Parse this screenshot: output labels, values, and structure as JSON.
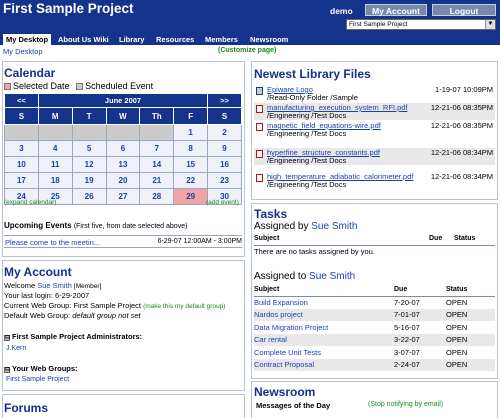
{
  "header": {
    "title": "First Sample Project",
    "user": "demo",
    "my_account_button": "My Account",
    "logout_button": "Logout",
    "project_select_value": "First Sample Project"
  },
  "nav": {
    "tabs": [
      "My Desktop",
      "About Us Wiki",
      "Library",
      "Resources",
      "Members",
      "Newsroom"
    ],
    "breadcrumb": "My Desktop",
    "customize": "(Customize page)"
  },
  "calendar": {
    "title": "Calendar",
    "legend_selected": "Selected Date",
    "legend_scheduled": "Scheduled Event",
    "prev": "<<",
    "month": "June 2007",
    "next": ">>",
    "days": [
      "S",
      "M",
      "T",
      "W",
      "Th",
      "F",
      "S"
    ],
    "weeks": [
      [
        "",
        "",
        "",
        "",
        "",
        "1",
        "2"
      ],
      [
        "3",
        "4",
        "5",
        "6",
        "7",
        "8",
        "9"
      ],
      [
        "10",
        "11",
        "12",
        "13",
        "14",
        "15",
        "16"
      ],
      [
        "17",
        "18",
        "19",
        "20",
        "21",
        "22",
        "23"
      ],
      [
        "24",
        "25",
        "26",
        "27",
        "28",
        "29",
        "30"
      ]
    ],
    "selected_day": "29",
    "expand_link": "(expand calendar)",
    "add_event_link": "(add event)",
    "upcoming_title": "Upcoming Events",
    "upcoming_note": "(First five, from date selected above)",
    "event_name": "Please come to the meetin...",
    "event_time": "6-29-07 12:00AM - 3:00PM",
    "colors": {
      "header": "#14338a",
      "selected": "#f2a3a6",
      "scheduled": "#c8d0e0",
      "empty": "#cbcbcb"
    }
  },
  "account": {
    "title": "My Account",
    "welcome_prefix": "Welcome",
    "user_name": "Sue Smith",
    "role": "[Member]",
    "last_login": "Your last login: 6-29-2007",
    "current_group": "Current Web Group: First Sample Project",
    "make_default": "(make this my default group)",
    "default_group_label": "Default Web Group:",
    "default_group_value": "default group not set",
    "admins_title": "First Sample Project Administrators:",
    "admin_name": "J.Kern",
    "groups_title": "Your Web Groups:",
    "group_name": "First Sample Project",
    "expand_glyph": "⊟"
  },
  "forums": {
    "title": "Forums"
  },
  "library": {
    "title": "Newest Library Files",
    "files": [
      {
        "name": "Epiware Logo",
        "date": "1-19-07 10:09PM",
        "path": "/Read-Only Folder /Sample",
        "icon": "folder-icon"
      },
      {
        "name": "manufacturing_execution_system_RFI.pdf",
        "date": "12-21-06 08:35PM",
        "path": "/Engineering /Test Docs",
        "icon": "pdf-icon"
      },
      {
        "name": "magnetic_field_equations-wire.pdf",
        "date": "12-21-06 08:35PM",
        "path": "/Engineering /Test Docs",
        "icon": "pdf-icon"
      },
      {
        "name": "hyperfine_structure_constants.pdf",
        "date": "12-21-06 08:34PM",
        "path": "/Engineering /Test Docs",
        "icon": "pdf-icon"
      },
      {
        "name": "high_temperature_adiabatic_calorimeter.pdf",
        "date": "12-21-06 08:34PM",
        "path": "/Engineering /Test Docs",
        "icon": "pdf-icon"
      }
    ]
  },
  "tasks": {
    "title": "Tasks",
    "assigned_by_label": "Assigned by",
    "assigned_to_label": "Assigned to",
    "user_name": "Sue Smith",
    "columns": {
      "subject": "Subject",
      "due": "Due",
      "status": "Status"
    },
    "no_tasks": "There are no tasks assigned by you.",
    "assigned_to": [
      {
        "subject": "Build Expansion",
        "due": "7-20-07",
        "status": "OPEN"
      },
      {
        "subject": "Nardos project",
        "due": "7-01-07",
        "status": "OPEN"
      },
      {
        "subject": "Data Migration Project",
        "due": "5-16-07",
        "status": "OPEN"
      },
      {
        "subject": "Car rental",
        "due": "3-22-07",
        "status": "OPEN"
      },
      {
        "subject": "Complete Unit Tests",
        "due": "3-07-07",
        "status": "OPEN"
      },
      {
        "subject": "Contract Proposal",
        "due": "2-24-07",
        "status": "OPEN"
      }
    ]
  },
  "newsroom": {
    "title": "Newsroom",
    "subtitle": "Messages of the Day",
    "stop_link": "(Stop notifying by email)"
  }
}
